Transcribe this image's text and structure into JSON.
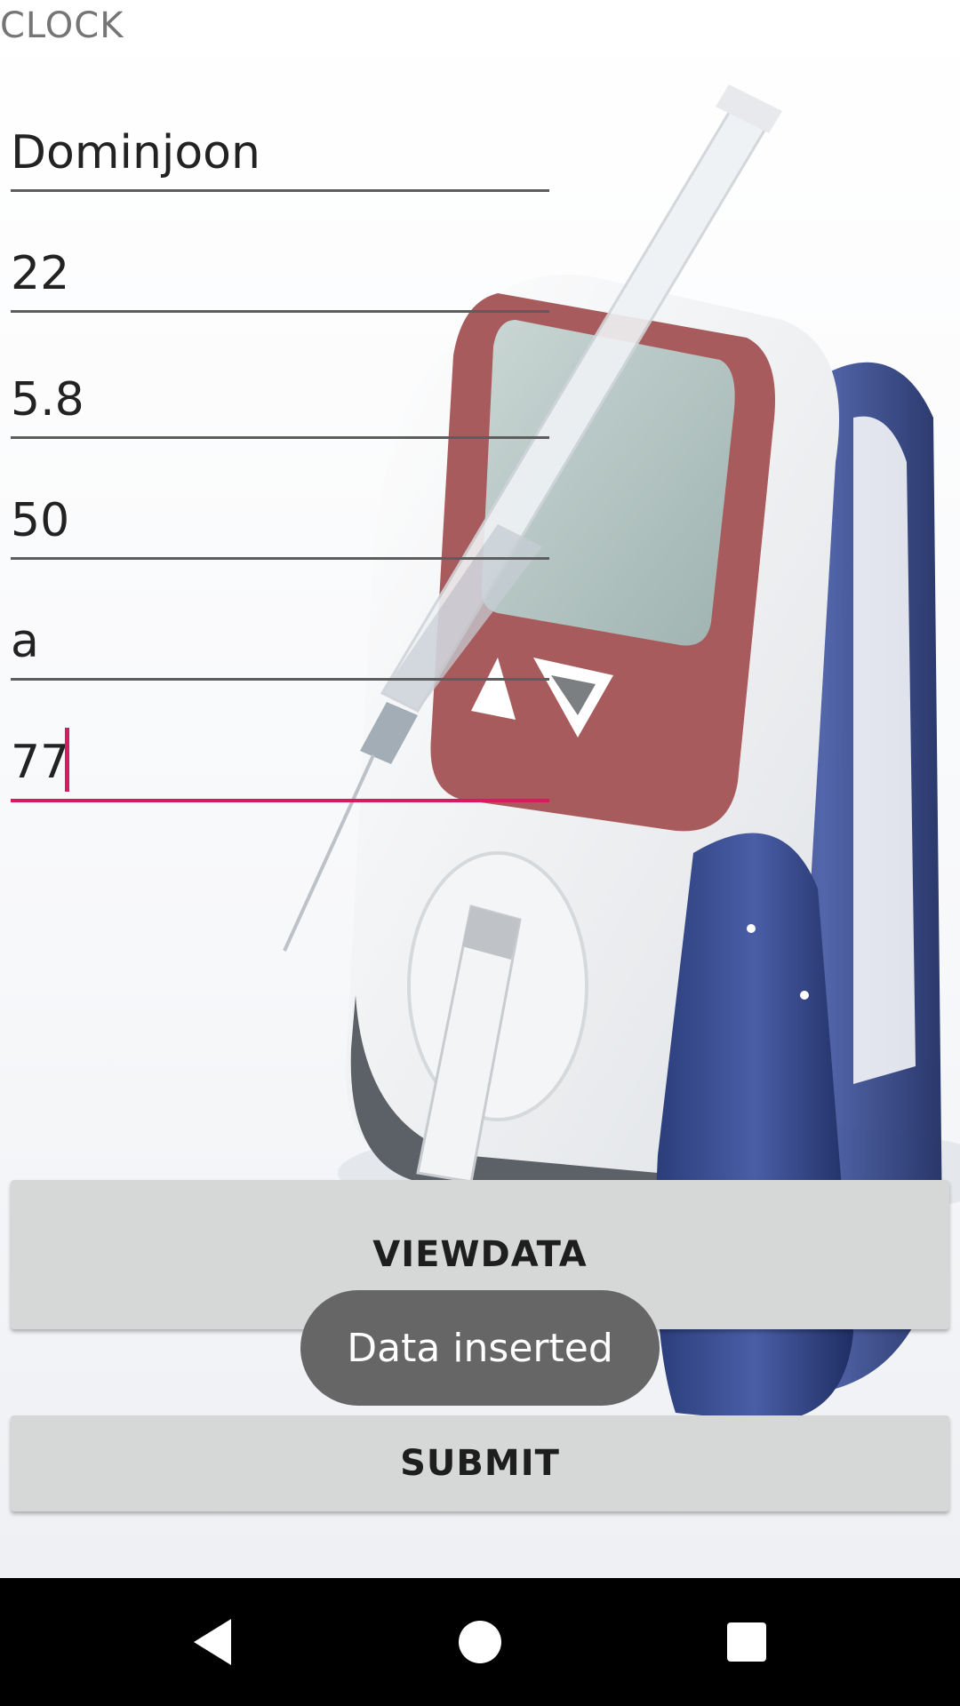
{
  "header": {
    "clock_label": "CLOCK"
  },
  "form": {
    "fields": [
      {
        "value": "Dominjoon"
      },
      {
        "value": "22"
      },
      {
        "value": "5.8"
      },
      {
        "value": "50"
      },
      {
        "value": "a"
      },
      {
        "value": "77"
      }
    ]
  },
  "buttons": {
    "viewdata_label": "VIEWDATA",
    "submit_label": "SUBMIT"
  },
  "toast": {
    "message": "Data inserted"
  },
  "colors": {
    "accent": "#d81b60",
    "button_bg": "#d6d7d7",
    "toast_bg": "#666666"
  },
  "navbar": {
    "icons": [
      "back-icon",
      "home-icon",
      "recents-icon"
    ]
  }
}
